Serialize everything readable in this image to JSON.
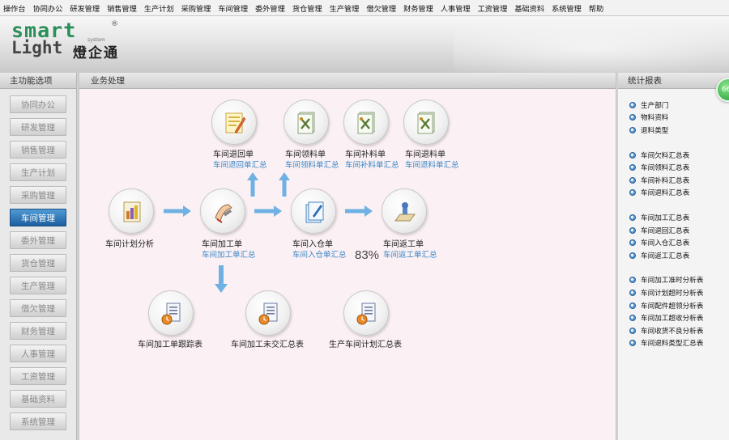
{
  "topmenu": [
    "操作台",
    "协同办公",
    "研发管理",
    "销售管理",
    "生产计划",
    "采购管理",
    "车间管理",
    "委外管理",
    "货仓管理",
    "生产管理",
    "借欠管理",
    "财务管理",
    "人事管理",
    "工资管理",
    "基础资料",
    "系统管理",
    "帮助"
  ],
  "logo": {
    "line1": "smart",
    "registered": "®",
    "system": "system",
    "line2": "Light",
    "brand_cn": "燈企通"
  },
  "left_panel": {
    "title": "主功能选项",
    "items": [
      "协同办公",
      "研发管理",
      "销售管理",
      "生产计划",
      "采购管理",
      "车间管理",
      "委外管理",
      "货仓管理",
      "生产管理",
      "借欠管理",
      "财务管理",
      "人事管理",
      "工资管理",
      "基础资料",
      "系统管理"
    ],
    "active_index": 5
  },
  "center_panel": {
    "title": "业务处理",
    "nodes": {
      "return_order": {
        "title": "车间退回单",
        "summary": "车间退回单汇总"
      },
      "pick_order": {
        "title": "车间领料单",
        "summary": "车间领料单汇总"
      },
      "supplement_order": {
        "title": "车间补料单",
        "summary": "车间补料单汇总"
      },
      "return_material_order": {
        "title": "车间退料单",
        "summary": "车间退料单汇总"
      },
      "plan_analysis": {
        "title": "车间计划分析"
      },
      "process_order": {
        "title": "车间加工单",
        "summary": "车间加工单汇总"
      },
      "warehouse_order": {
        "title": "车间入仓单",
        "summary": "车间入仓单汇总"
      },
      "rework_order": {
        "title": "车间返工单",
        "summary": "车间返工单汇总"
      },
      "tracking_report": {
        "title": "车间加工单跟踪表"
      },
      "unsubmitted_summary": {
        "title": "车间加工未交汇总表"
      },
      "plan_summary": {
        "title": "生产车间计划汇总表"
      }
    },
    "progress_text": "83%"
  },
  "right_panel": {
    "title": "统计报表",
    "groups": [
      [
        "生产部门",
        "物料资料",
        "退料类型"
      ],
      [
        "车间欠料汇总表",
        "车间领料汇总表",
        "车间补料汇总表",
        "车间退料汇总表"
      ],
      [
        "车间加工汇总表",
        "车间退回汇总表",
        "车间入仓汇总表",
        "车间返工汇总表"
      ],
      [
        "车间加工准时分析表",
        "车间计划超时分析表",
        "车间配件超领分析表",
        "车间加工超收分析表",
        "车间收货不良分析表",
        "车间退料类型汇总表"
      ]
    ]
  },
  "float_badge": "66",
  "colors": {
    "accent_blue": "#1d5f9e",
    "link_blue": "#3a86c6",
    "arrow_blue": "#6fb1e3",
    "logo_green": "#2a8f58"
  }
}
